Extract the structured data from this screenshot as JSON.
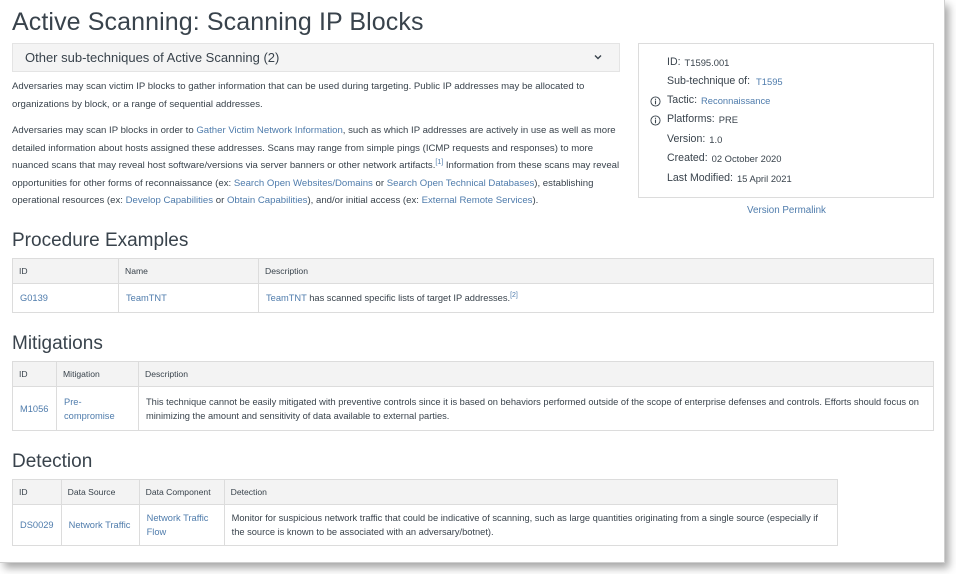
{
  "page": {
    "title": "Active Scanning: Scanning IP Blocks",
    "subtechniques_label": "Other sub-techniques of Active Scanning (2)"
  },
  "description": {
    "p1": "Adversaries may scan victim IP blocks to gather information that can be used during targeting. Public IP addresses may be allocated to organizations by block, or a range of sequential addresses.",
    "p2_a": "Adversaries may scan IP blocks in order to ",
    "link_gather": "Gather Victim Network Information",
    "p2_b": ", such as which IP addresses are actively in use as well as more detailed information about hosts assigned these addresses. Scans may range from simple pings (ICMP requests and responses) to more nuanced scans that may reveal host software/versions via server banners or other network artifacts.",
    "ref1": "[1]",
    "p2_c": " Information from these scans may reveal opportunities for other forms of reconnaissance (ex: ",
    "link_websites": "Search Open Websites/Domains",
    "p2_or1": " or ",
    "link_tech_db": "Search Open Technical Databases",
    "p2_d": "), establishing operational resources (ex: ",
    "link_dev_cap": "Develop Capabilities",
    "p2_or2": " or ",
    "link_obtain_cap": "Obtain Capabilities",
    "p2_e": "), and/or initial access (ex: ",
    "link_ext_remote": "External Remote Services",
    "p2_f": ")."
  },
  "card": {
    "id_label": "ID:",
    "id_value": "T1595.001",
    "sub_label": "Sub-technique of:",
    "sub_value": "T1595",
    "tactic_label": "Tactic:",
    "tactic_value": "Reconnaissance",
    "platforms_label": "Platforms:",
    "platforms_value": "PRE",
    "version_label": "Version:",
    "version_value": "1.0",
    "created_label": "Created:",
    "created_value": "02 October 2020",
    "modified_label": "Last Modified:",
    "modified_value": "15 April 2021",
    "permalink": "Version Permalink"
  },
  "procedures": {
    "heading": "Procedure Examples",
    "headers": [
      "ID",
      "Name",
      "Description"
    ],
    "rows": [
      {
        "id": "G0139",
        "name": "TeamTNT",
        "desc_link": "TeamTNT",
        "desc": " has scanned specific lists of target IP addresses.",
        "ref": "[2]"
      }
    ]
  },
  "mitigations": {
    "heading": "Mitigations",
    "headers": [
      "ID",
      "Mitigation",
      "Description"
    ],
    "rows": [
      {
        "id": "M1056",
        "name": "Pre-compromise",
        "desc": "This technique cannot be easily mitigated with preventive controls since it is based on behaviors performed outside of the scope of enterprise defenses and controls. Efforts should focus on minimizing the amount and sensitivity of data available to external parties."
      }
    ]
  },
  "detection": {
    "heading": "Detection",
    "headers": [
      "ID",
      "Data Source",
      "Data Component",
      "Detection"
    ],
    "rows": [
      {
        "id": "DS0029",
        "source": "Network Traffic",
        "component": "Network Traffic Flow",
        "desc": "Monitor for suspicious network traffic that could be indicative of scanning, such as large quantities originating from a single source (especially if the source is known to be associated with an adversary/botnet)."
      }
    ]
  },
  "colors": {
    "link": "#4f7cac",
    "text": "#39434c",
    "header_bg": "#f3f3f3"
  }
}
